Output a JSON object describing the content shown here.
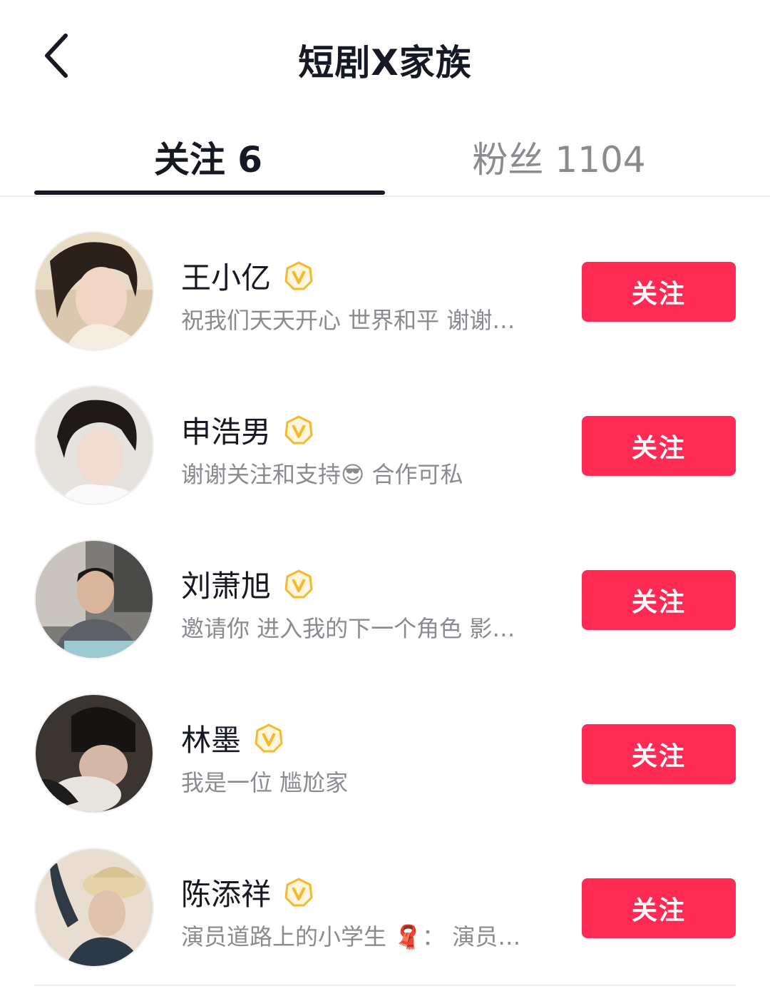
{
  "header": {
    "title": "短剧X家族"
  },
  "tabs": [
    {
      "label": "关注 6",
      "active": true
    },
    {
      "label": "粉丝 1104",
      "active": false
    }
  ],
  "users": [
    {
      "name": "王小亿",
      "bio": "祝我们天天开心 世界和平 谢谢…",
      "button": "关注",
      "verified": true
    },
    {
      "name": "申浩男",
      "bio": "谢谢关注和支持😎 合作可私",
      "button": "关注",
      "verified": true
    },
    {
      "name": "刘萧旭",
      "bio": "邀请你 进入我的下一个角色 影…",
      "button": "关注",
      "verified": true
    },
    {
      "name": "林墨",
      "bio": "我是一位 尴尬家",
      "button": "关注",
      "verified": true
    },
    {
      "name": "陈添祥",
      "bio": "演员道路上的小学生 🧣： 演员…",
      "button": "关注",
      "verified": true
    }
  ],
  "colors": {
    "accent": "#fe2c55",
    "badge": "#f5b82e",
    "text": "#161823",
    "secondary": "#8a8b91"
  }
}
